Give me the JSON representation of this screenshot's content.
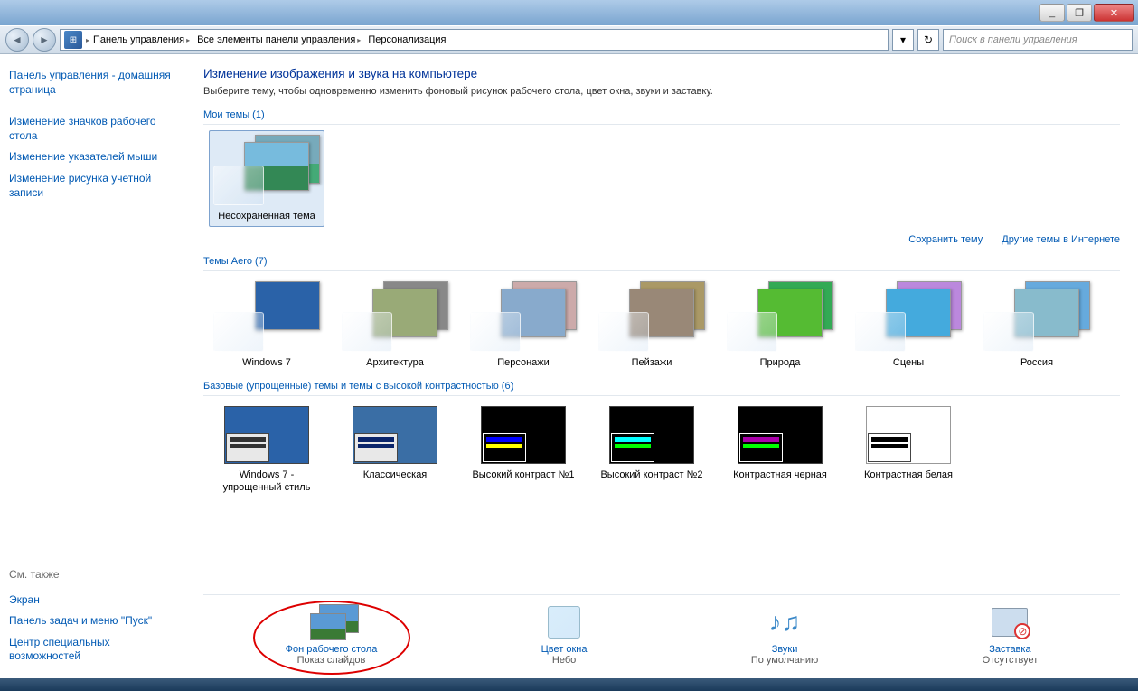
{
  "window": {
    "min": "_",
    "max": "❐",
    "close": "✕"
  },
  "breadcrumbs": {
    "c1": "Панель управления",
    "c2": "Все элементы панели управления",
    "c3": "Персонализация"
  },
  "search": {
    "placeholder": "Поиск в панели управления"
  },
  "sidebar": {
    "home": "Панель управления - домашняя страница",
    "l1": "Изменение значков рабочего стола",
    "l2": "Изменение указателей мыши",
    "l3": "Изменение рисунка учетной записи",
    "see_also": "См. также",
    "s1": "Экран",
    "s2": "Панель задач и меню \"Пуск\"",
    "s3": "Центр специальных возможностей"
  },
  "content": {
    "heading": "Изменение изображения и звука на компьютере",
    "subtext": "Выберите тему, чтобы одновременно изменить фоновый рисунок рабочего стола, цвет окна, звуки и заставку.",
    "my_themes": "Мои темы (1)",
    "unsaved": "Несохраненная тема",
    "save_theme": "Сохранить тему",
    "more_online": "Другие темы в Интернете",
    "aero_themes": "Темы Aero (7)",
    "aero": {
      "t1": "Windows 7",
      "t2": "Архитектура",
      "t3": "Персонажи",
      "t4": "Пейзажи",
      "t5": "Природа",
      "t6": "Сцены",
      "t7": "Россия"
    },
    "basic_label": "Базовые (упрощенные) темы и темы с высокой контрастностью (6)",
    "basic": {
      "b1": "Windows 7 - упрощенный стиль",
      "b2": "Классическая",
      "b3": "Высокий контраст №1",
      "b4": "Высокий контраст №2",
      "b5": "Контрастная черная",
      "b6": "Контрастная белая"
    }
  },
  "settings": {
    "bg": {
      "title": "Фон рабочего стола",
      "sub": "Показ слайдов"
    },
    "color": {
      "title": "Цвет окна",
      "sub": "Небо"
    },
    "sound": {
      "title": "Звуки",
      "sub": "По умолчанию"
    },
    "saver": {
      "title": "Заставка",
      "sub": "Отсутствует"
    }
  }
}
